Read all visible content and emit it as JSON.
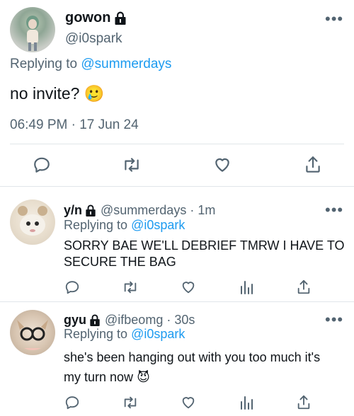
{
  "main_tweet": {
    "display_name": "gowon",
    "handle": "@i0spark",
    "replying_prefix": "Replying to",
    "replying_handle": "@summerdays",
    "text": "no invite?",
    "emoji": "🥲",
    "timestamp": "06:49 PM · 17 Jun 24"
  },
  "replies": [
    {
      "display_name": "y/n",
      "handle": "@summerdays",
      "time_separator": "·",
      "time": "1m",
      "replying_prefix": "Replying to",
      "replying_handle": "@i0spark",
      "text_line1": "SORRY BAE WE'LL DEBRIEF TMRW I HAVE TO",
      "text_line2": "SECURE THE BAG"
    },
    {
      "display_name": "gyu",
      "handle": "@ifbeomg",
      "time_separator": "·",
      "time": "30s",
      "replying_prefix": "Replying to",
      "replying_handle": "@i0spark",
      "text_line1": "she's been hanging out with you too much it's",
      "text_line2": "my turn now",
      "emoji": "😈"
    }
  ],
  "icons": {
    "more": "more-dots-icon",
    "lock": "lock-icon",
    "reply": "reply-icon",
    "retweet": "retweet-icon",
    "like": "like-icon",
    "views": "views-icon",
    "share": "share-icon"
  },
  "colors": {
    "text": "#0f1419",
    "muted": "#536471",
    "link": "#1d9bf0",
    "divider": "#e1e6ea"
  }
}
